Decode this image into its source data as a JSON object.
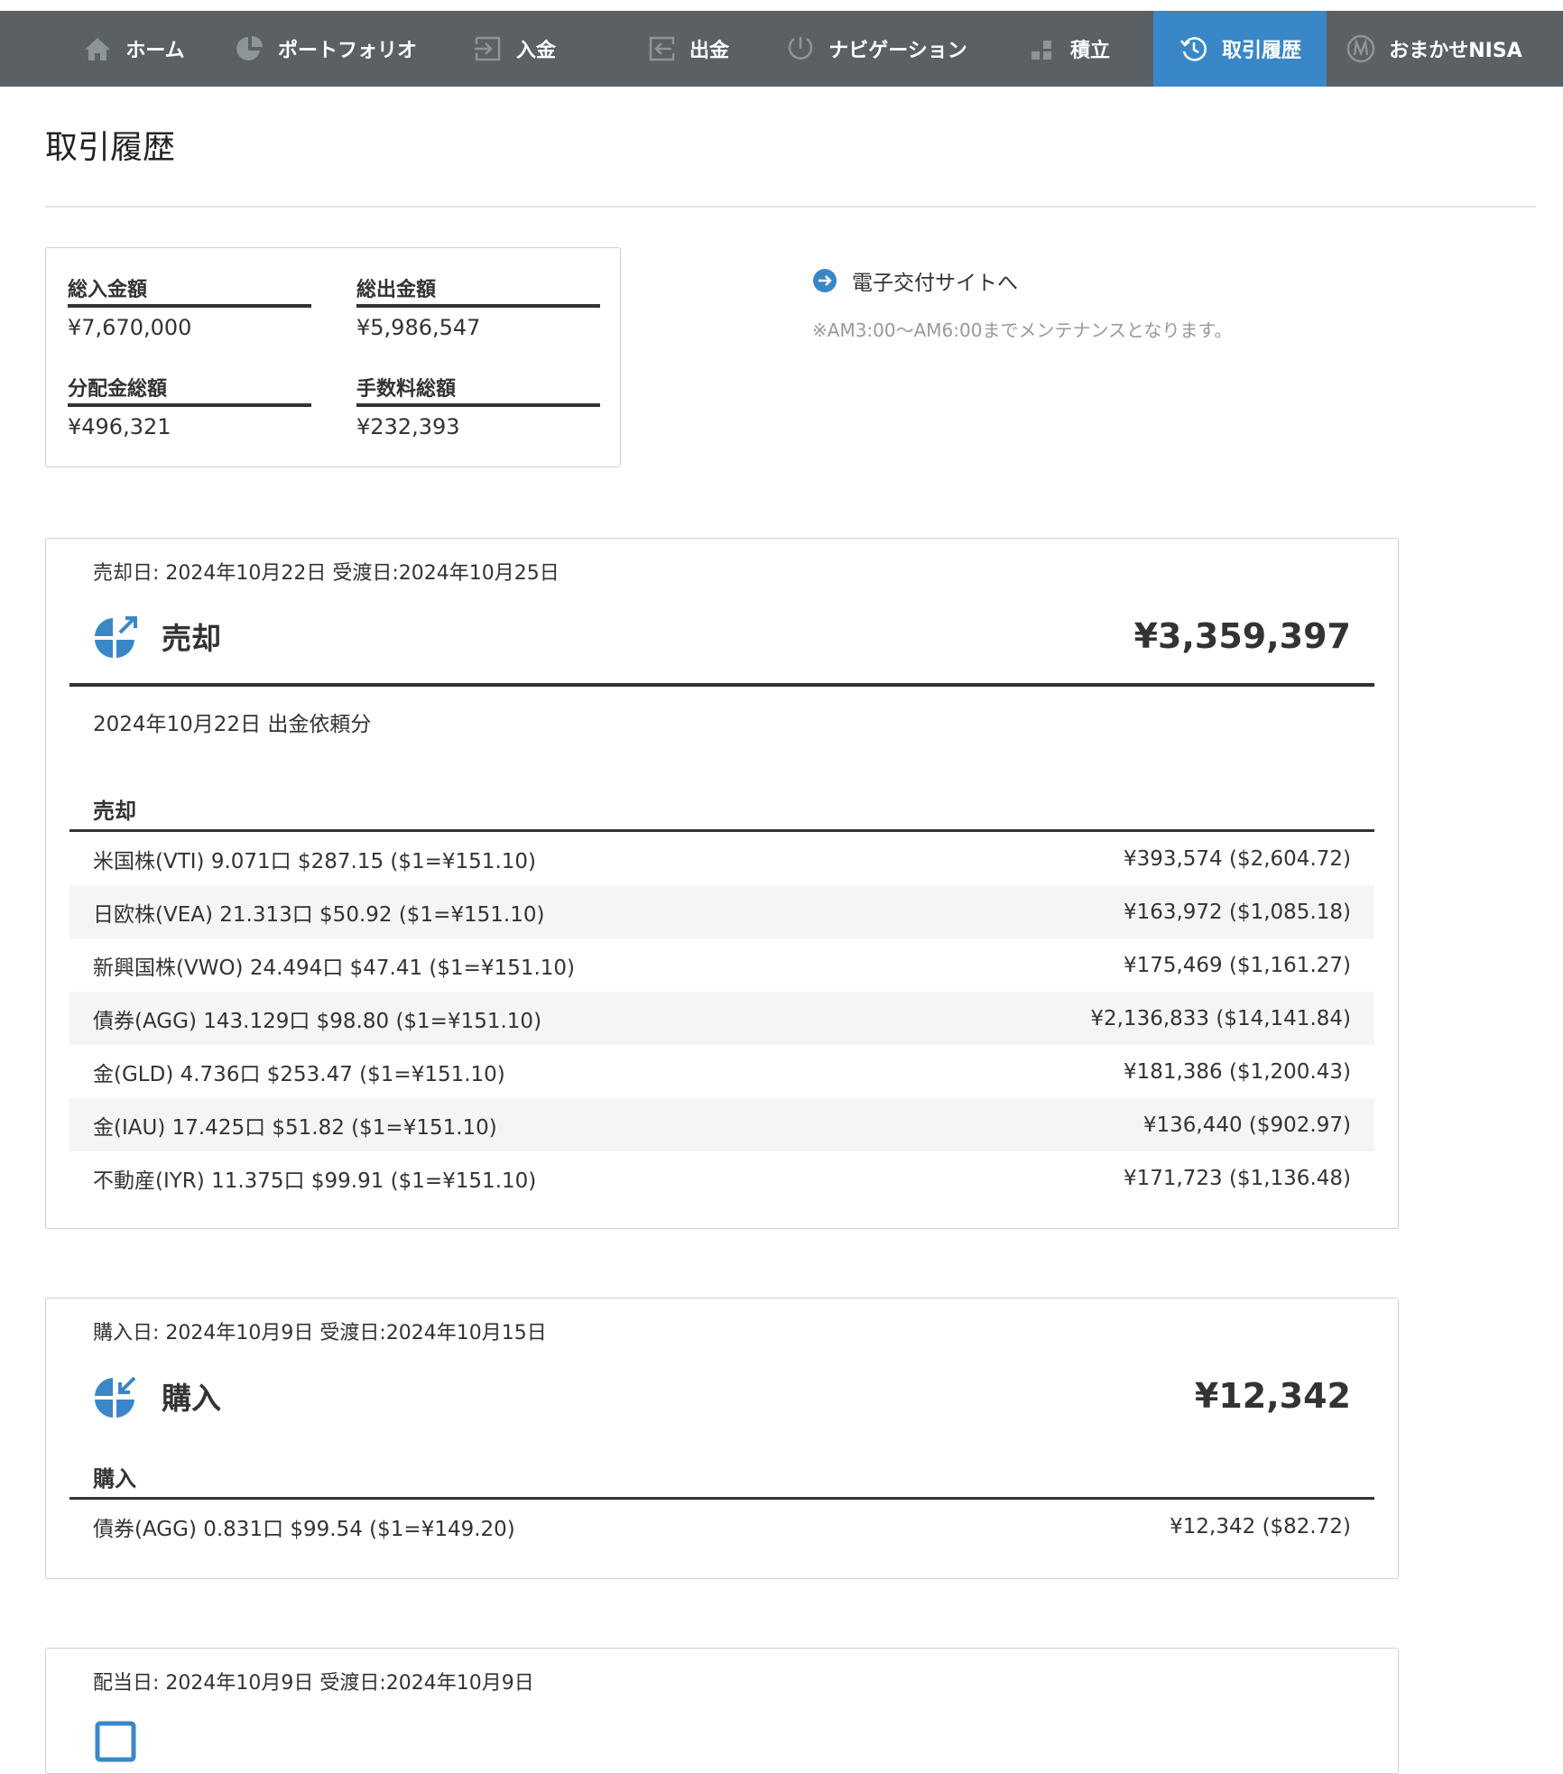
{
  "nav": {
    "items": [
      {
        "label": "ホーム",
        "icon": "home-icon"
      },
      {
        "label": "ポートフォリオ",
        "icon": "pie-chart-icon"
      },
      {
        "label": "入金",
        "icon": "deposit-icon"
      },
      {
        "label": "出金",
        "icon": "withdraw-icon"
      },
      {
        "label": "ナビゲーション",
        "icon": "gauge-icon"
      },
      {
        "label": "積立",
        "icon": "blocks-icon"
      },
      {
        "label": "取引履歴",
        "icon": "history-icon"
      },
      {
        "label": "おまかせNISA",
        "icon": "nisa-icon"
      }
    ],
    "active": "取引履歴"
  },
  "page": {
    "title": "取引履歴"
  },
  "summary": {
    "total_deposit_label": "総入金額",
    "total_deposit": "¥7,670,000",
    "total_withdraw_label": "総出金額",
    "total_withdraw": "¥5,986,547",
    "dividend_label": "分配金総額",
    "dividend": "¥496,321",
    "fee_label": "手数料総額",
    "fee": "¥232,393"
  },
  "external": {
    "link_label": "電子交付サイトへ",
    "note": "※AM3:00〜AM6:00までメンテナンスとなります。"
  },
  "sale": {
    "date_line": "売却日: 2024年10月22日 受渡日:2024年10月25日",
    "type": "売却",
    "amount": "¥3,359,397",
    "subtitle": "2024年10月22日 出金依頼分",
    "section_label": "売却",
    "rows": [
      {
        "desc": "米国株(VTI) 9.071口 $287.15 ($1=¥151.10)",
        "amount": "¥393,574 ($2,604.72)"
      },
      {
        "desc": "日欧株(VEA) 21.313口 $50.92 ($1=¥151.10)",
        "amount": "¥163,972 ($1,085.18)"
      },
      {
        "desc": "新興国株(VWO) 24.494口 $47.41 ($1=¥151.10)",
        "amount": "¥175,469 ($1,161.27)"
      },
      {
        "desc": "債券(AGG) 143.129口 $98.80 ($1=¥151.10)",
        "amount": "¥2,136,833 ($14,141.84)"
      },
      {
        "desc": "金(GLD) 4.736口 $253.47 ($1=¥151.10)",
        "amount": "¥181,386 ($1,200.43)"
      },
      {
        "desc": "金(IAU) 17.425口 $51.82 ($1=¥151.10)",
        "amount": "¥136,440 ($902.97)"
      },
      {
        "desc": "不動産(IYR) 11.375口 $99.91 ($1=¥151.10)",
        "amount": "¥171,723 ($1,136.48)"
      }
    ]
  },
  "purchase": {
    "date_line": "購入日: 2024年10月9日 受渡日:2024年10月15日",
    "type": "購入",
    "amount": "¥12,342",
    "section_label": "購入",
    "rows": [
      {
        "desc": "債券(AGG) 0.831口 $99.54 ($1=¥149.20)",
        "amount": "¥12,342 ($82.72)"
      }
    ]
  },
  "dividend": {
    "date_line": "配当日: 2024年10月9日 受渡日:2024年10月9日"
  },
  "colors": {
    "nav_bg": "#5a6063",
    "nav_active": "#3a87c8",
    "accent_icon": "#3a87c8"
  }
}
